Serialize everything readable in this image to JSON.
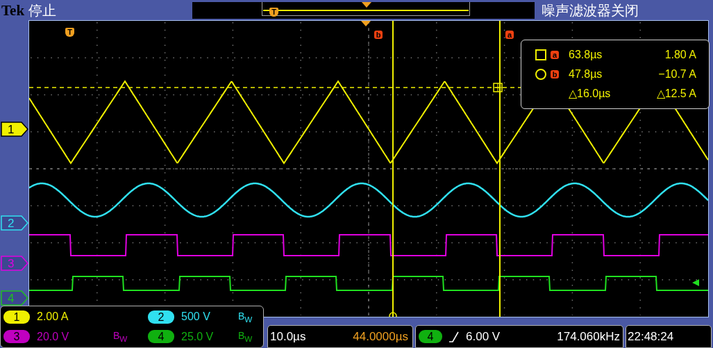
{
  "header": {
    "brand": "Tek",
    "status": "停止",
    "noise_filter": "噪声滤波器关闭",
    "record_trigger_marker": "T"
  },
  "plot": {
    "trigger_marker": "T",
    "cursor_labels": [
      {
        "letter": "b"
      },
      {
        "letter": "a"
      }
    ]
  },
  "channel_markers": [
    {
      "number": "1",
      "color": "#f0f000",
      "selected": true
    },
    {
      "number": "2",
      "color": "#30e0f0",
      "selected": false
    },
    {
      "number": "3",
      "color": "#e000e0",
      "selected": false
    },
    {
      "number": "4",
      "color": "#20c020",
      "selected": false
    }
  ],
  "readout": [
    {
      "kind": "square",
      "letter": "a",
      "time": "63.8µs",
      "value": "1.80 A"
    },
    {
      "kind": "circle",
      "letter": "b",
      "time": "47.8µs",
      "value": "−10.7 A"
    },
    {
      "kind": "delta",
      "time": "△16.0µs",
      "value": "△12.5 A"
    }
  ],
  "channels": [
    {
      "number": "1",
      "scale": "2.00 A",
      "color": "#f0f000"
    },
    {
      "number": "2",
      "scale": "500 V",
      "bandwidth": "B$_{W}$",
      "color": "#30e0f0"
    },
    {
      "number": "3",
      "scale": "20.0 V",
      "bandwidth": "B$_{W}$",
      "color": "#c000c0"
    },
    {
      "number": "4",
      "scale": "25.0 V",
      "bandwidth": "B$_{W}$",
      "color": "#10b010"
    }
  ],
  "timebase": {
    "scale": "10.0µs",
    "position": "44.0000µs"
  },
  "trigger": {
    "source": "4",
    "color": "#10b010",
    "kind": "rising",
    "level": "6.00 V",
    "frequency": "174.060kHz"
  },
  "clock": "22:48:24"
}
